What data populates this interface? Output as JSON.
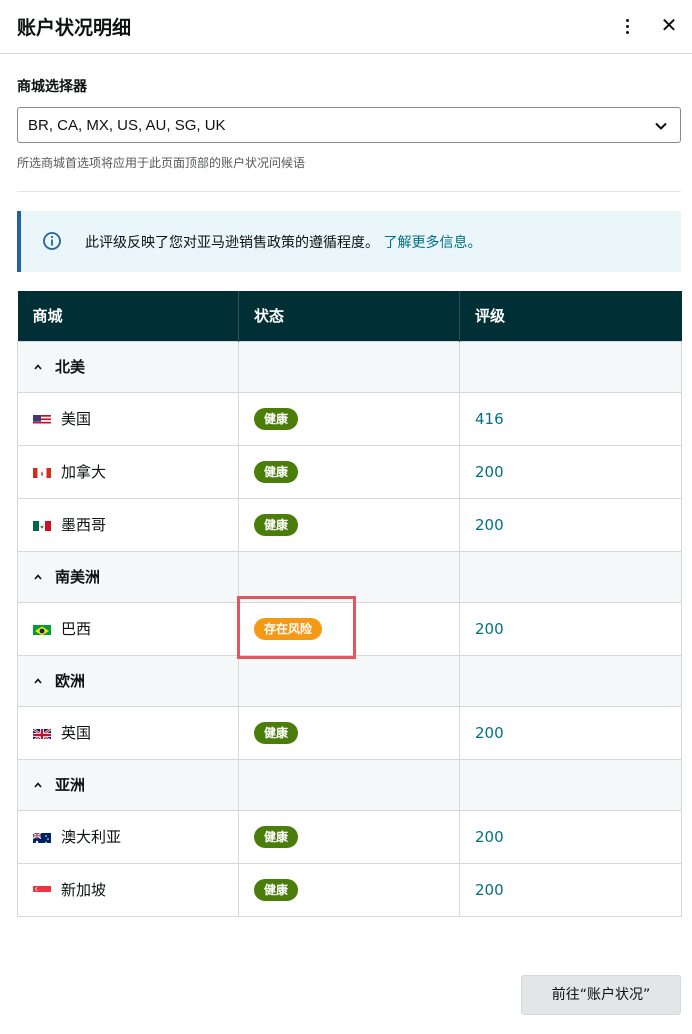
{
  "header": {
    "title": "账户状况明细",
    "menu_icon": "kebab-menu-icon",
    "close_icon": "close-icon",
    "close_glyph": "✕"
  },
  "marketplace_selector": {
    "label": "商城选择器",
    "value": "BR, CA, MX, US, AU, SG, UK",
    "helper": "所选商城首选项将应用于此页面顶部的账户状况问候语"
  },
  "info_banner": {
    "icon": "info-icon",
    "text": "此评级反映了您对亚马逊销售政策的遵循程度。",
    "link": "了解更多信息。"
  },
  "table": {
    "headers": [
      "商城",
      "状态",
      "评级"
    ],
    "rows": [
      {
        "type": "group",
        "name": "北美"
      },
      {
        "type": "country",
        "name": "美国",
        "flag": "us",
        "status": "健康",
        "status_kind": "ok",
        "rating": "416"
      },
      {
        "type": "country",
        "name": "加拿大",
        "flag": "ca",
        "status": "健康",
        "status_kind": "ok",
        "rating": "200"
      },
      {
        "type": "country",
        "name": "墨西哥",
        "flag": "mx",
        "status": "健康",
        "status_kind": "ok",
        "rating": "200"
      },
      {
        "type": "group",
        "name": "南美洲"
      },
      {
        "type": "country",
        "name": "巴西",
        "flag": "br",
        "status": "存在风险",
        "status_kind": "risk",
        "rating": "200"
      },
      {
        "type": "group",
        "name": "欧洲"
      },
      {
        "type": "country",
        "name": "英国",
        "flag": "uk",
        "status": "健康",
        "status_kind": "ok",
        "rating": "200"
      },
      {
        "type": "group",
        "name": "亚洲"
      },
      {
        "type": "country",
        "name": "澳大利亚",
        "flag": "au",
        "status": "健康",
        "status_kind": "ok",
        "rating": "200"
      },
      {
        "type": "country",
        "name": "新加坡",
        "flag": "sg",
        "status": "健康",
        "status_kind": "ok",
        "rating": "200"
      }
    ]
  },
  "colors": {
    "header_bg": "#002f36",
    "healthy": "#4b7d0a",
    "at_risk": "#f59a16",
    "link": "#007185",
    "highlight": "#e3565f"
  },
  "footer": {
    "button_label": "前往“账户状况”"
  }
}
